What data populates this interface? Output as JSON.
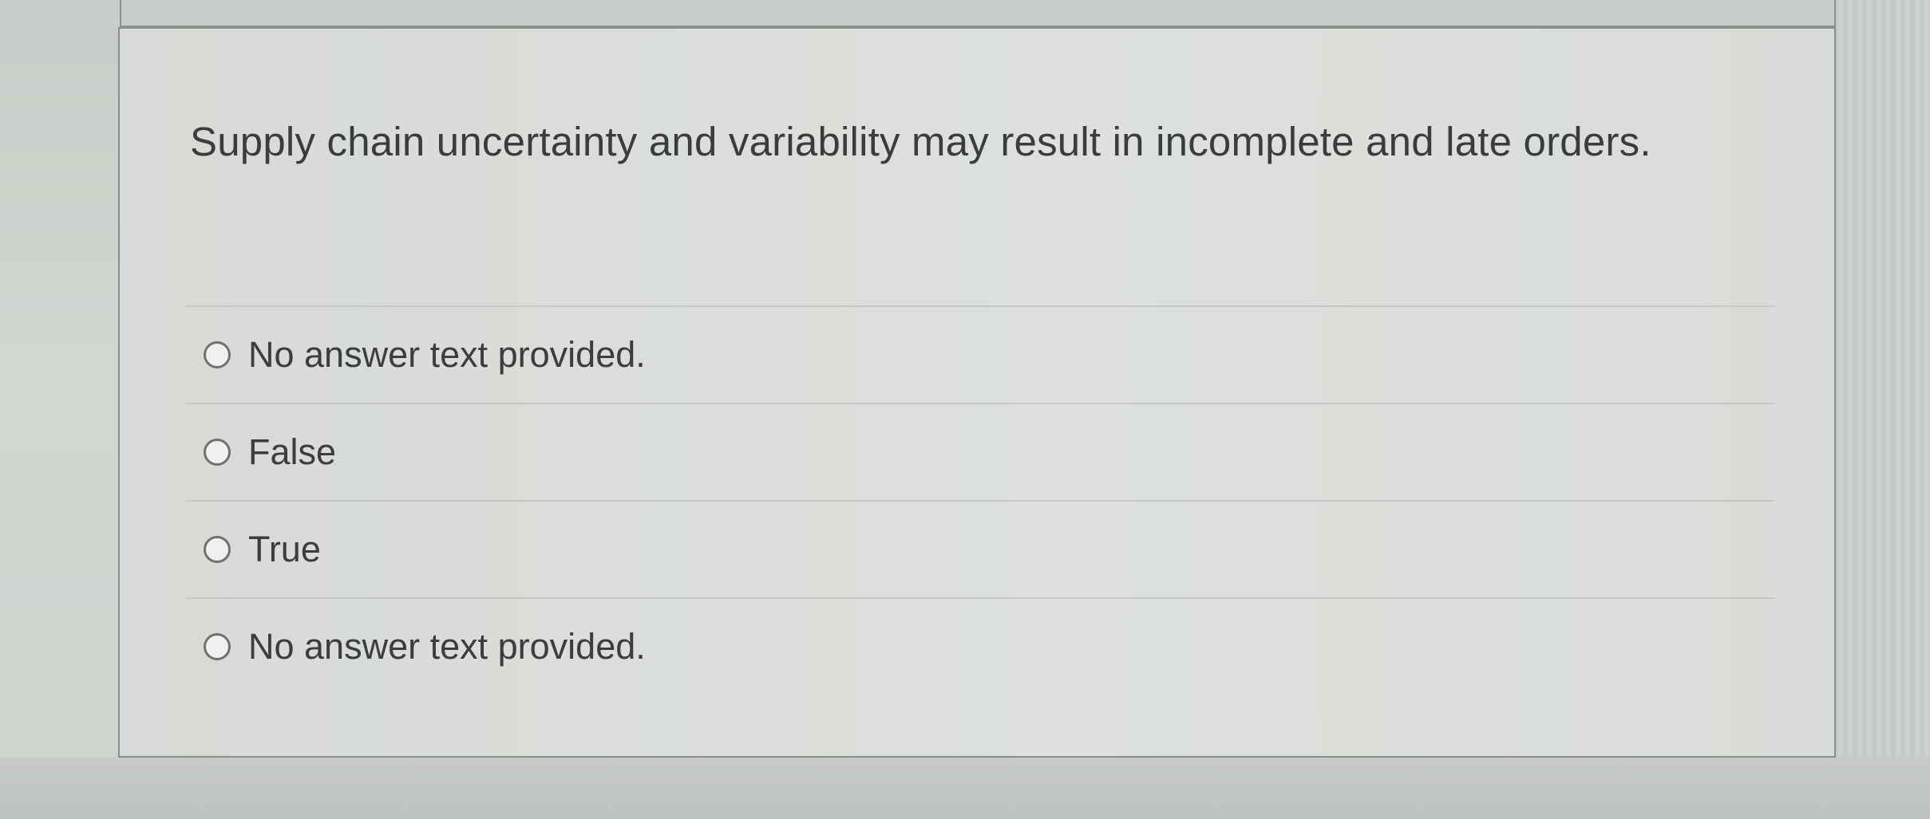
{
  "question": {
    "text": "Supply chain uncertainty and variability may result in incomplete and late orders."
  },
  "answers": [
    {
      "label": "No answer text provided."
    },
    {
      "label": "False"
    },
    {
      "label": "True"
    },
    {
      "label": "No answer text provided."
    }
  ]
}
